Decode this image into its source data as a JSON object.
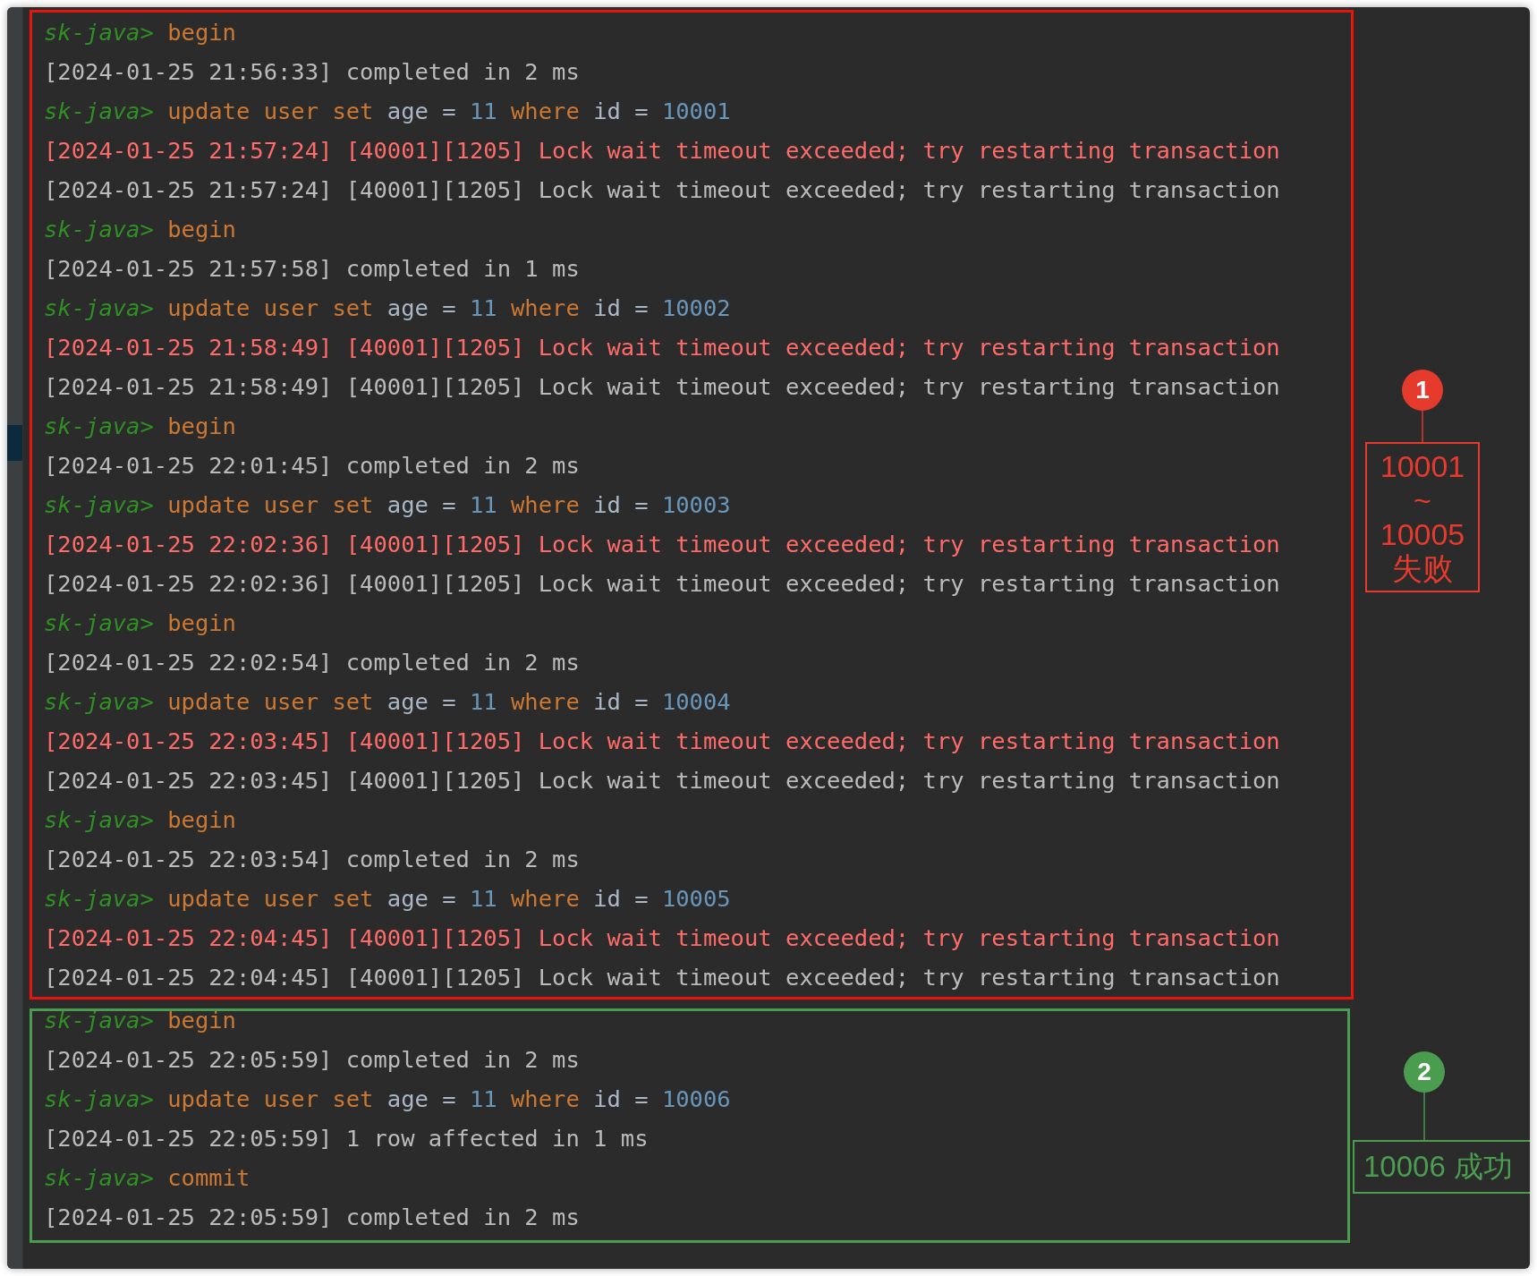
{
  "sections": [
    {
      "color": "#e8150f",
      "lines": [
        [
          {
            "kind": "prompt",
            "text": "sk-java>"
          },
          {
            "kind": "keyword",
            "text": " begin"
          }
        ],
        [
          {
            "kind": "output",
            "text": "[2024-01-25 21:56:33] completed in 2 ms"
          }
        ],
        [
          {
            "kind": "prompt",
            "text": "sk-java>"
          },
          {
            "kind": "keyword",
            "text": " update user set"
          },
          {
            "kind": "plain",
            "text": " age = "
          },
          {
            "kind": "number",
            "text": "11"
          },
          {
            "kind": "keyword",
            "text": " where"
          },
          {
            "kind": "plain",
            "text": " id = "
          },
          {
            "kind": "number",
            "text": "10001"
          }
        ],
        [
          {
            "kind": "error",
            "text": "[2024-01-25 21:57:24] [40001][1205] Lock wait timeout exceeded; try restarting transaction"
          }
        ],
        [
          {
            "kind": "output",
            "text": "[2024-01-25 21:57:24] [40001][1205] Lock wait timeout exceeded; try restarting transaction"
          }
        ],
        [
          {
            "kind": "prompt",
            "text": "sk-java>"
          },
          {
            "kind": "keyword",
            "text": " begin"
          }
        ],
        [
          {
            "kind": "output",
            "text": "[2024-01-25 21:57:58] completed in 1 ms"
          }
        ],
        [
          {
            "kind": "prompt",
            "text": "sk-java>"
          },
          {
            "kind": "keyword",
            "text": " update user set"
          },
          {
            "kind": "plain",
            "text": " age = "
          },
          {
            "kind": "number",
            "text": "11"
          },
          {
            "kind": "keyword",
            "text": " where"
          },
          {
            "kind": "plain",
            "text": " id = "
          },
          {
            "kind": "number",
            "text": "10002"
          }
        ],
        [
          {
            "kind": "error",
            "text": "[2024-01-25 21:58:49] [40001][1205] Lock wait timeout exceeded; try restarting transaction"
          }
        ],
        [
          {
            "kind": "output",
            "text": "[2024-01-25 21:58:49] [40001][1205] Lock wait timeout exceeded; try restarting transaction"
          }
        ],
        [
          {
            "kind": "prompt",
            "text": "sk-java>"
          },
          {
            "kind": "keyword",
            "text": " begin"
          }
        ],
        [
          {
            "kind": "output",
            "text": "[2024-01-25 22:01:45] completed in 2 ms"
          }
        ],
        [
          {
            "kind": "prompt",
            "text": "sk-java>"
          },
          {
            "kind": "keyword",
            "text": " update user set"
          },
          {
            "kind": "plain",
            "text": " age = "
          },
          {
            "kind": "number",
            "text": "11"
          },
          {
            "kind": "keyword",
            "text": " where"
          },
          {
            "kind": "plain",
            "text": " id = "
          },
          {
            "kind": "number",
            "text": "10003"
          }
        ],
        [
          {
            "kind": "error",
            "text": "[2024-01-25 22:02:36] [40001][1205] Lock wait timeout exceeded; try restarting transaction"
          }
        ],
        [
          {
            "kind": "output",
            "text": "[2024-01-25 22:02:36] [40001][1205] Lock wait timeout exceeded; try restarting transaction"
          }
        ],
        [
          {
            "kind": "prompt",
            "text": "sk-java>"
          },
          {
            "kind": "keyword",
            "text": " begin"
          }
        ],
        [
          {
            "kind": "output",
            "text": "[2024-01-25 22:02:54] completed in 2 ms"
          }
        ],
        [
          {
            "kind": "prompt",
            "text": "sk-java>"
          },
          {
            "kind": "keyword",
            "text": " update user set"
          },
          {
            "kind": "plain",
            "text": " age = "
          },
          {
            "kind": "number",
            "text": "11"
          },
          {
            "kind": "keyword",
            "text": " where"
          },
          {
            "kind": "plain",
            "text": " id = "
          },
          {
            "kind": "number",
            "text": "10004"
          }
        ],
        [
          {
            "kind": "error",
            "text": "[2024-01-25 22:03:45] [40001][1205] Lock wait timeout exceeded; try restarting transaction"
          }
        ],
        [
          {
            "kind": "output",
            "text": "[2024-01-25 22:03:45] [40001][1205] Lock wait timeout exceeded; try restarting transaction"
          }
        ],
        [
          {
            "kind": "prompt",
            "text": "sk-java>"
          },
          {
            "kind": "keyword",
            "text": " begin"
          }
        ],
        [
          {
            "kind": "output",
            "text": "[2024-01-25 22:03:54] completed in 2 ms"
          }
        ],
        [
          {
            "kind": "prompt",
            "text": "sk-java>"
          },
          {
            "kind": "keyword",
            "text": " update user set"
          },
          {
            "kind": "plain",
            "text": " age = "
          },
          {
            "kind": "number",
            "text": "11"
          },
          {
            "kind": "keyword",
            "text": " where"
          },
          {
            "kind": "plain",
            "text": " id = "
          },
          {
            "kind": "number",
            "text": "10005"
          }
        ],
        [
          {
            "kind": "error",
            "text": "[2024-01-25 22:04:45] [40001][1205] Lock wait timeout exceeded; try restarting transaction"
          }
        ],
        [
          {
            "kind": "output",
            "text": "[2024-01-25 22:04:45] [40001][1205] Lock wait timeout exceeded; try restarting transaction"
          }
        ]
      ]
    },
    {
      "color": "#4a9d4f",
      "lines": [
        [
          {
            "kind": "prompt",
            "text": "sk-java>"
          },
          {
            "kind": "keyword",
            "text": " begin"
          }
        ],
        [
          {
            "kind": "output",
            "text": "[2024-01-25 22:05:59] completed in 2 ms"
          }
        ],
        [
          {
            "kind": "prompt",
            "text": "sk-java>"
          },
          {
            "kind": "keyword",
            "text": " update user set"
          },
          {
            "kind": "plain",
            "text": " age = "
          },
          {
            "kind": "number",
            "text": "11"
          },
          {
            "kind": "keyword",
            "text": " where"
          },
          {
            "kind": "plain",
            "text": " id = "
          },
          {
            "kind": "number",
            "text": "10006"
          }
        ],
        [
          {
            "kind": "output",
            "text": "[2024-01-25 22:05:59] 1 row affected in 1 ms"
          }
        ],
        [
          {
            "kind": "prompt",
            "text": "sk-java>"
          },
          {
            "kind": "keyword",
            "text": " commit"
          }
        ],
        [
          {
            "kind": "output",
            "text": "[2024-01-25 22:05:59] completed in 2 ms"
          }
        ]
      ]
    }
  ],
  "callouts": [
    {
      "number": "1",
      "color": "#e53a2c",
      "text": [
        "10001",
        "~",
        "10005",
        "失败"
      ]
    },
    {
      "number": "2",
      "color": "#4a9d4f",
      "text": [
        "10006 成功"
      ]
    }
  ]
}
